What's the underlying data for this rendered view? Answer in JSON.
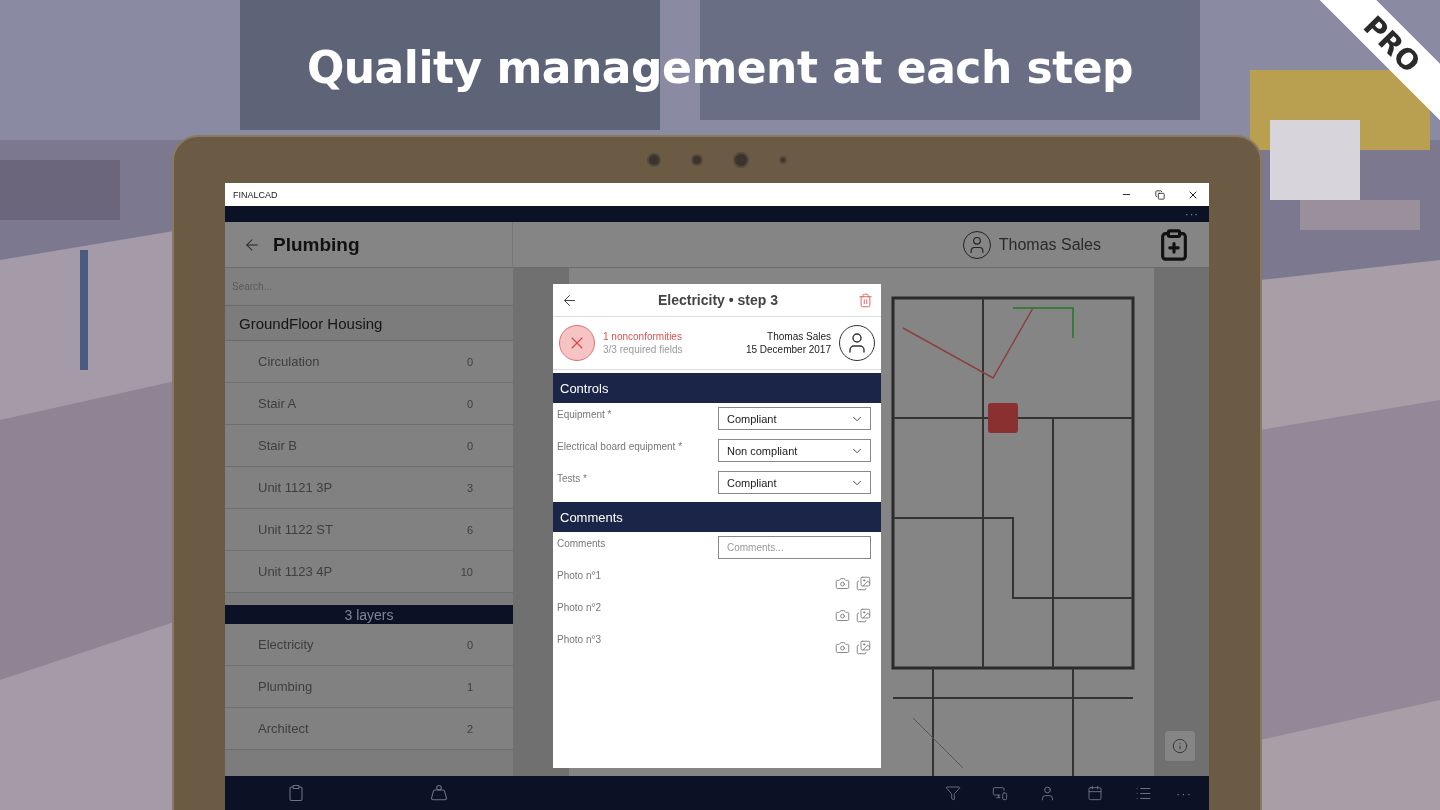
{
  "headline": "Quality management at each step",
  "badge": "PRO",
  "window": {
    "title": "FINALCAD",
    "more": "···"
  },
  "header": {
    "title": "Plumbing",
    "user": "Thomas Sales"
  },
  "sidebar": {
    "search_placeholder": "Search...",
    "group": "GroundFloor Housing",
    "items": [
      {
        "label": "Circulation",
        "count": "0"
      },
      {
        "label": "Stair A",
        "count": "0"
      },
      {
        "label": "Stair B",
        "count": "0"
      },
      {
        "label": "Unit 1121 3P",
        "count": "3"
      },
      {
        "label": "Unit 1122 ST",
        "count": "6"
      },
      {
        "label": "Unit 1123 4P",
        "count": "10"
      }
    ],
    "layers_header": "3 layers",
    "layers": [
      {
        "label": "Electricity",
        "count": "0"
      },
      {
        "label": "Plumbing",
        "count": "1"
      },
      {
        "label": "Architect",
        "count": "2"
      }
    ]
  },
  "form": {
    "title": "Electricity • step 3",
    "nonconformities": "1 nonconformities",
    "required": "3/3 required fields",
    "user": "Thomas Sales",
    "date": "15 December 2017",
    "sections": [
      {
        "title": "Controls",
        "fields": [
          {
            "kind": "select",
            "label": "Equipment *",
            "value": "Compliant"
          },
          {
            "kind": "select",
            "label": "Electrical board equipment *",
            "value": "Non compliant"
          },
          {
            "kind": "select",
            "label": "Tests *",
            "value": "Compliant"
          }
        ]
      },
      {
        "title": "Comments",
        "fields": [
          {
            "kind": "text",
            "label": "Comments",
            "placeholder": "Comments..."
          },
          {
            "label": "Photo n°1"
          },
          {
            "label": "Photo n°2"
          },
          {
            "label": "Photo n°3"
          }
        ]
      }
    ]
  },
  "bottom_bar": {
    "more": "···"
  }
}
